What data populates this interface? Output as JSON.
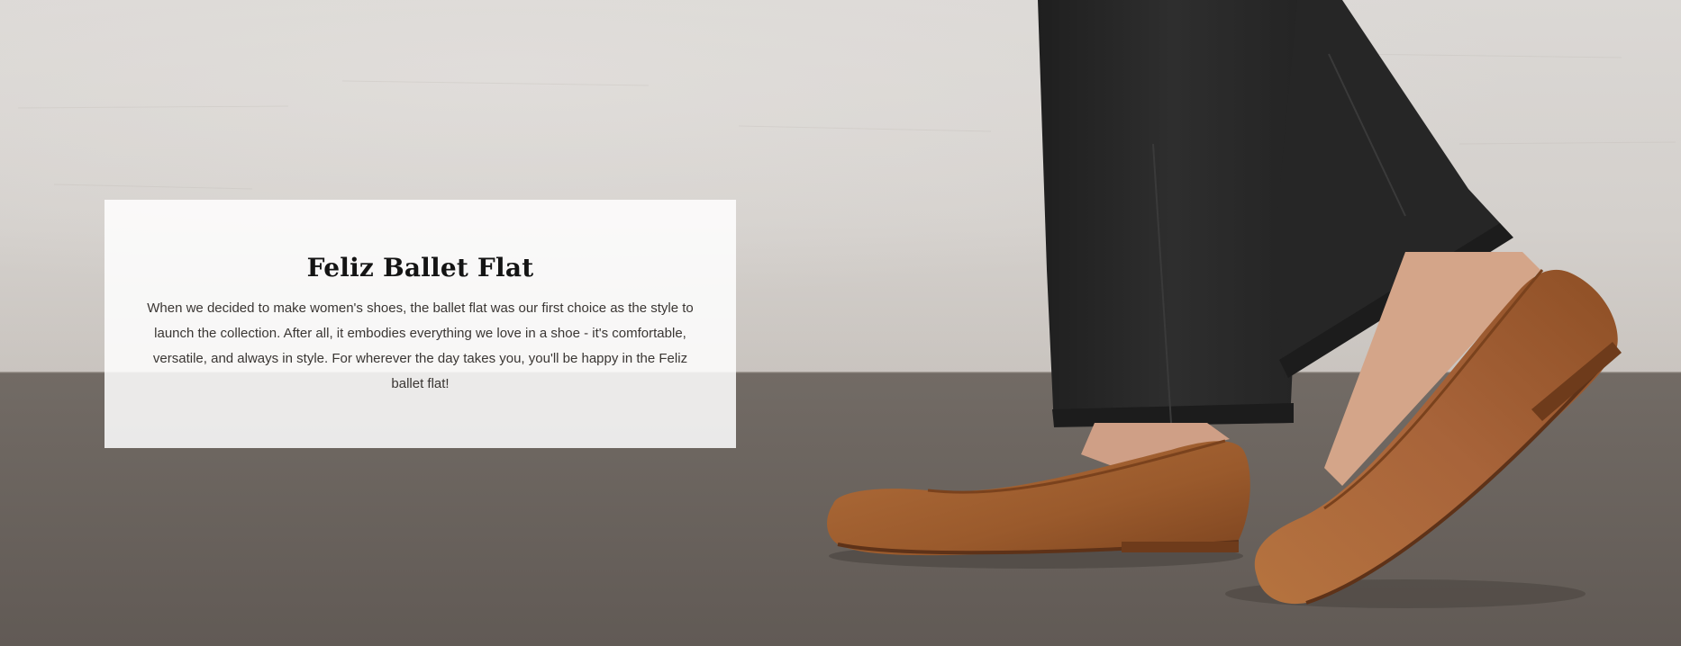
{
  "hero": {
    "title": "Feliz Ballet Flat",
    "description": "When we decided to make women's shoes, the ballet flat was our first choice as the style to launch the collection. After all, it embodies everything we love in a shoe - it's comfortable, versatile, and always in style. For wherever the day takes you, you'll be happy in the Feliz ballet flat!",
    "image_subject": "woman-walking-in-cognac-leather-ballet-flats-and-black-jeans",
    "colors": {
      "wall": "#d6d2ce",
      "floor": "#6b6560",
      "shoe_leather": "#9a5a2c",
      "denim": "#2a2a2a",
      "card_background": "#ffffff",
      "title_text": "#141414",
      "body_text": "#3a3633"
    }
  }
}
